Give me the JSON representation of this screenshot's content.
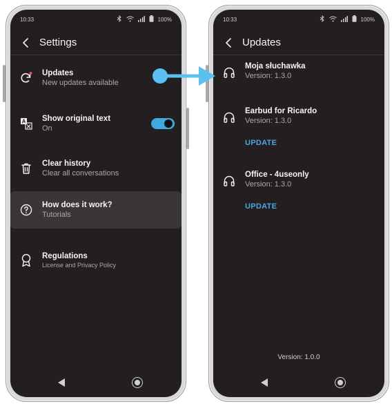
{
  "left_phone": {
    "status": {
      "time": "10:33",
      "battery": "100%"
    },
    "header": {
      "title": "Settings"
    },
    "items": [
      {
        "title": "Updates",
        "subtitle": "New updates available"
      },
      {
        "title": "Show original text",
        "subtitle": "On"
      },
      {
        "title": "Clear history",
        "subtitle": "Clear all conversations"
      },
      {
        "title": "How does it work?",
        "subtitle": "Tutorials"
      },
      {
        "title": "Regulations",
        "subtitle": "License and Privacy Policy"
      }
    ],
    "toggle_on": true
  },
  "right_phone": {
    "status": {
      "time": "10:33",
      "battery": "100%"
    },
    "header": {
      "title": "Updates"
    },
    "devices": [
      {
        "name": "Moja słuchawka",
        "version": "Version: 1.3.0",
        "action": ""
      },
      {
        "name": "Earbud for Ricardo",
        "version": "Version: 1.3.0",
        "action": "UPDATE"
      },
      {
        "name": "Office - 4useonly",
        "version": "Version: 1.3.0",
        "action": "UPDATE"
      }
    ],
    "app_version": "Version: 1.0.0"
  },
  "colors": {
    "accent": "#40a9df",
    "screen_bg": "#231f20",
    "notification_dot": "#e84a6a",
    "connector": "#5bc0f0"
  }
}
